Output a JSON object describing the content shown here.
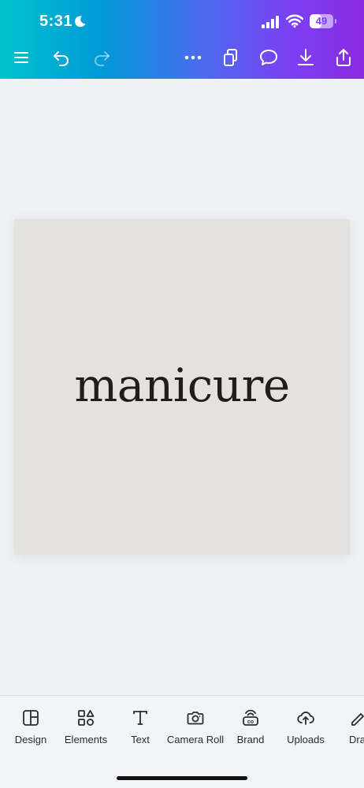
{
  "status_bar": {
    "time": "5:31",
    "battery_level": "49",
    "battery_fraction": 0.49
  },
  "toolbar": {
    "icons": [
      "menu-icon",
      "undo-icon",
      "redo-icon",
      "more-icon",
      "pages-icon",
      "comment-icon",
      "download-icon",
      "share-icon"
    ]
  },
  "design": {
    "text": "manicure",
    "background_color": "#e4e2de",
    "text_color": "#1f1e1d"
  },
  "bottom_tools": [
    {
      "label": "Design",
      "icon": "layout-icon"
    },
    {
      "label": "Elements",
      "icon": "shapes-icon"
    },
    {
      "label": "Text",
      "icon": "text-icon"
    },
    {
      "label": "Camera Roll",
      "icon": "camera-icon"
    },
    {
      "label": "Brand",
      "icon": "brand-icon"
    },
    {
      "label": "Uploads",
      "icon": "upload-cloud-icon"
    },
    {
      "label": "Dra",
      "icon": "draw-icon"
    }
  ],
  "colors": {
    "gradient_start": "#00c4cc",
    "gradient_end": "#8a2be2"
  }
}
